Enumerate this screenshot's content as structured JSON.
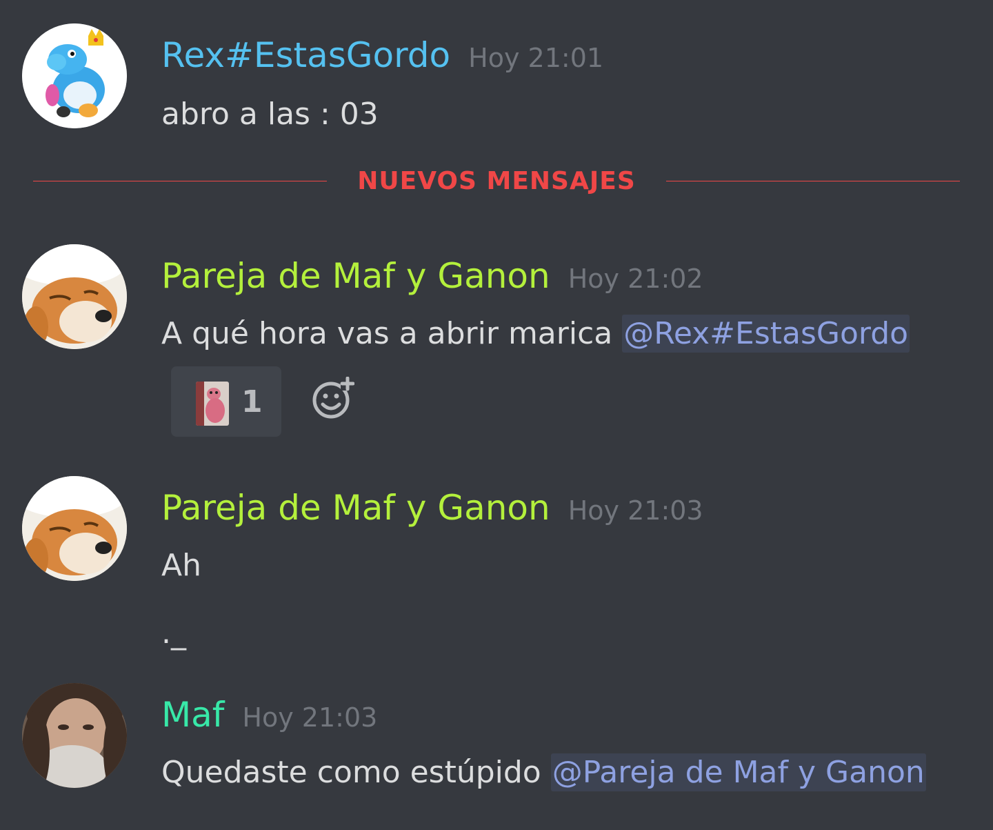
{
  "colors": {
    "background": "#36393f",
    "rex_name": "#55c1f0",
    "pareja_name": "#b4f03c",
    "maf_name": "#38e8a8",
    "timestamp": "#72767d",
    "new_messages": "#f04747",
    "mention": "#8ea1e1"
  },
  "divider": {
    "label": "NUEVOS MENSAJES"
  },
  "messages": [
    {
      "author": "Rex#EstasGordo",
      "timestamp": "Hoy 21:01",
      "text": "abro a las : 03"
    },
    {
      "author": "Pareja de Maf y Ganon",
      "timestamp": "Hoy 21:02",
      "text": "A qué hora vas a abrir marica ",
      "mention": "@Rex#EstasGordo",
      "reaction": {
        "emoji": "pink-figure-emoji",
        "count": "1"
      }
    },
    {
      "author": "Pareja de Maf y Ganon",
      "timestamp": "Hoy 21:03",
      "lines": [
        "Ah",
        "._"
      ]
    },
    {
      "author": "Maf",
      "timestamp": "Hoy 21:03",
      "text": "Quedaste como estúpido ",
      "mention": "@Pareja de Maf y Ganon"
    }
  ]
}
